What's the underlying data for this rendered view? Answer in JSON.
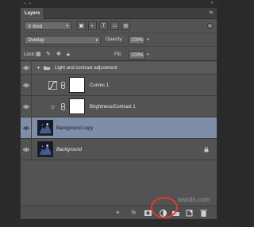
{
  "panel": {
    "tab_label": "Layers"
  },
  "filter": {
    "kind_label": "Kind"
  },
  "blend": {
    "mode": "Overlay",
    "opacity_label": "Opacity:",
    "opacity_value": "100%"
  },
  "lock": {
    "label": "Lock:",
    "fill_label": "Fill:",
    "fill_value": "100%"
  },
  "layers": {
    "group": "Light and contrast adjustment",
    "items": [
      {
        "label": "Curves 1"
      },
      {
        "label": "Brightness/Contrast 1"
      },
      {
        "label": "Background copy"
      },
      {
        "label": "Background"
      }
    ]
  },
  "watermark": "wsxdn.com",
  "colors": {
    "selection": "#7e8da8",
    "highlight_ring": "#e23b2e",
    "panel_bg": "#535353"
  }
}
